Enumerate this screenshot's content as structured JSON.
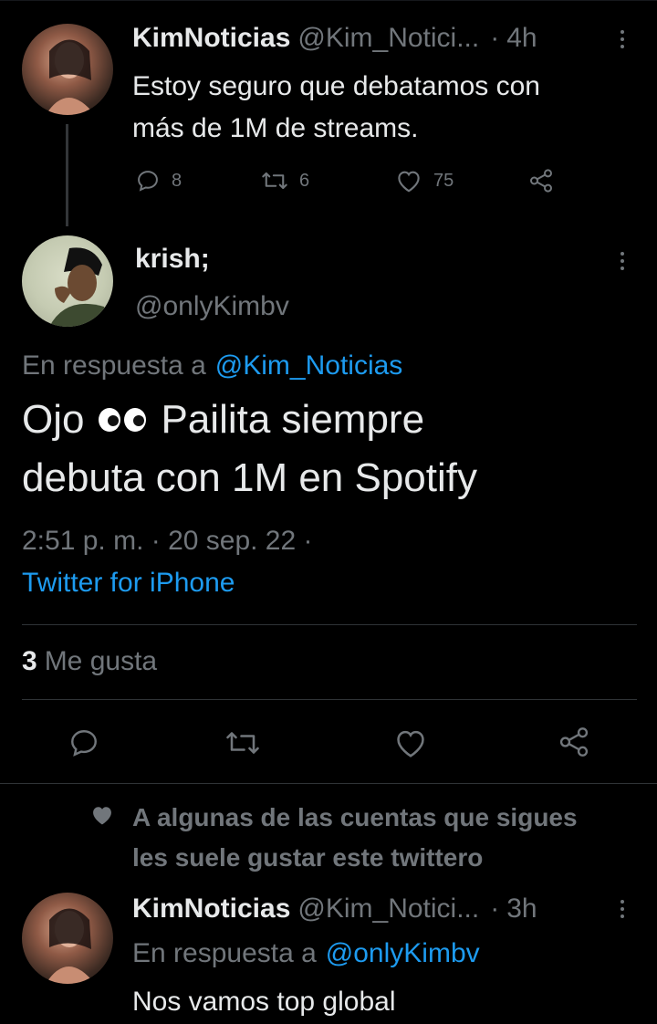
{
  "tweet1": {
    "display_name": "KimNoticias",
    "handle": "@Kim_Notici...",
    "sep": "·",
    "time": "4h",
    "text_line1": "Estoy seguro que debatamos con",
    "text_line2": "más de 1M de streams.",
    "replies": "8",
    "retweets": "6",
    "likes": "75"
  },
  "main_tweet": {
    "display_name": "krish;",
    "handle": "@onlyKimbv",
    "reply_prefix": "En respuesta a",
    "reply_to": "@Kim_Noticias",
    "text_line1_a": "Ojo",
    "emoji": "👀",
    "text_line1_b": "Pailita siempre",
    "text_line2": "debuta con 1M en Spotify",
    "timestamp": "2:51 p. m. · 20 sep. 22 ·",
    "source": "Twitter for iPhone",
    "likes_count": "3",
    "likes_label": "Me gusta"
  },
  "suggestion": {
    "line1": "A algunas de las cuentas que sigues",
    "line2": "les suele gustar este twittero"
  },
  "tweet3": {
    "display_name": "KimNoticias",
    "handle": "@Kim_Notici...",
    "sep": "·",
    "time": "3h",
    "reply_prefix": "En respuesta a",
    "reply_to": "@onlyKimbv",
    "text": "Nos vamos top global"
  },
  "colors": {
    "background": "#000000",
    "text": "#e7e9ea",
    "secondary": "#71767b",
    "accent": "#1d9bf0",
    "divider": "#2f3336"
  }
}
